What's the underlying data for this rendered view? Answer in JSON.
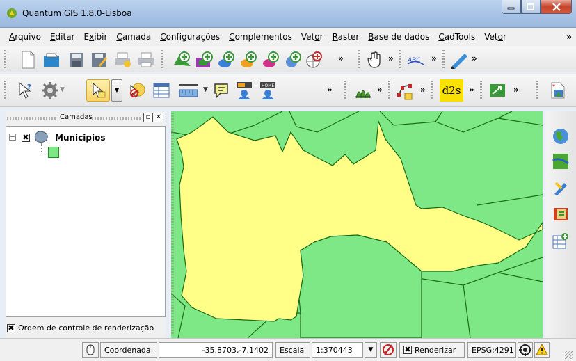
{
  "window": {
    "title": "Quantum GIS 1.8.0-Lisboa"
  },
  "menu": {
    "items": [
      {
        "pre": "",
        "u": "A",
        "post": "rquivo"
      },
      {
        "pre": "",
        "u": "E",
        "post": "ditar"
      },
      {
        "pre": "E",
        "u": "x",
        "post": "ibir"
      },
      {
        "pre": "",
        "u": "C",
        "post": "amada"
      },
      {
        "pre": "",
        "u": "C",
        "post": "onfigurações"
      },
      {
        "pre": "",
        "u": "C",
        "post": "omplementos"
      },
      {
        "pre": "Vet",
        "u": "o",
        "post": "r"
      },
      {
        "pre": "",
        "u": "R",
        "post": "aster"
      },
      {
        "pre": "",
        "u": "B",
        "post": "ase de dados"
      },
      {
        "pre": "",
        "u": "C",
        "post": "adTools"
      },
      {
        "pre": "Vet",
        "u": "o",
        "post": "r"
      }
    ],
    "more": "»"
  },
  "toolbar": {
    "chevron": "»",
    "d2s_label": "d2s"
  },
  "layers_panel": {
    "title": "Camadas",
    "float_btn": "▫",
    "close_btn": "✕",
    "layer_name": "Municipios",
    "render_order_label": "Ordem de controle de renderização",
    "render_order_check": "✖"
  },
  "status": {
    "coord_label": "Coordenada:",
    "coord_value": "-35.8703,-7.1402",
    "scale_label": "Escala",
    "scale_value": "1:370443",
    "render_label": "Renderizar",
    "render_check": "✖",
    "crs": "EPSG:4291"
  },
  "colors": {
    "polygon_fill": "#ffff88",
    "neighbors_fill": "#7ee886",
    "border": "#1a6b1a"
  }
}
